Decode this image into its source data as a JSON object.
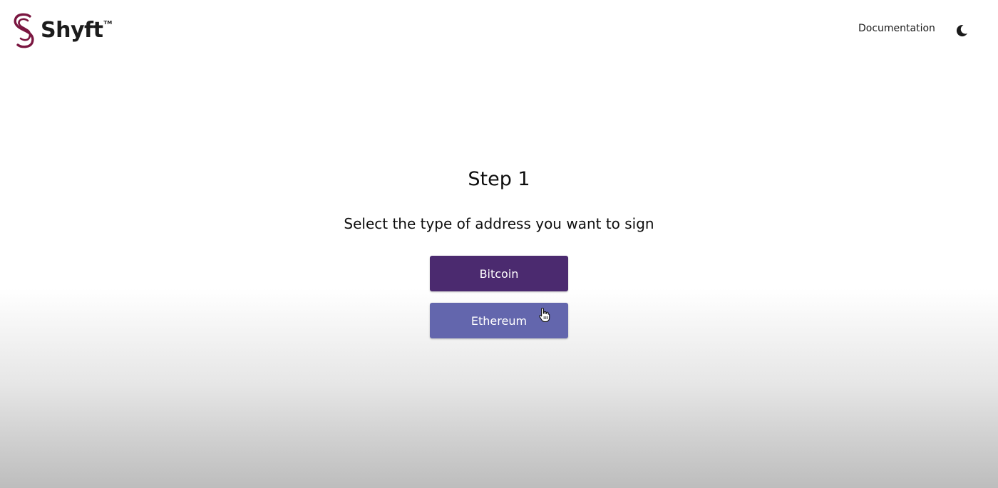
{
  "header": {
    "logo_text": "Shyft",
    "logo_tm": "TM",
    "nav_documentation": "Documentation",
    "theme_toggle_icon": "moon-icon"
  },
  "main": {
    "step_title": "Step 1",
    "instruction": "Select the type of address you want to sign",
    "options": [
      {
        "label": "Bitcoin"
      },
      {
        "label": "Ethereum"
      }
    ]
  },
  "colors": {
    "brand": "#7a1640",
    "bitcoin_button": "#4b2a6f",
    "ethereum_button": "#6366ad"
  }
}
